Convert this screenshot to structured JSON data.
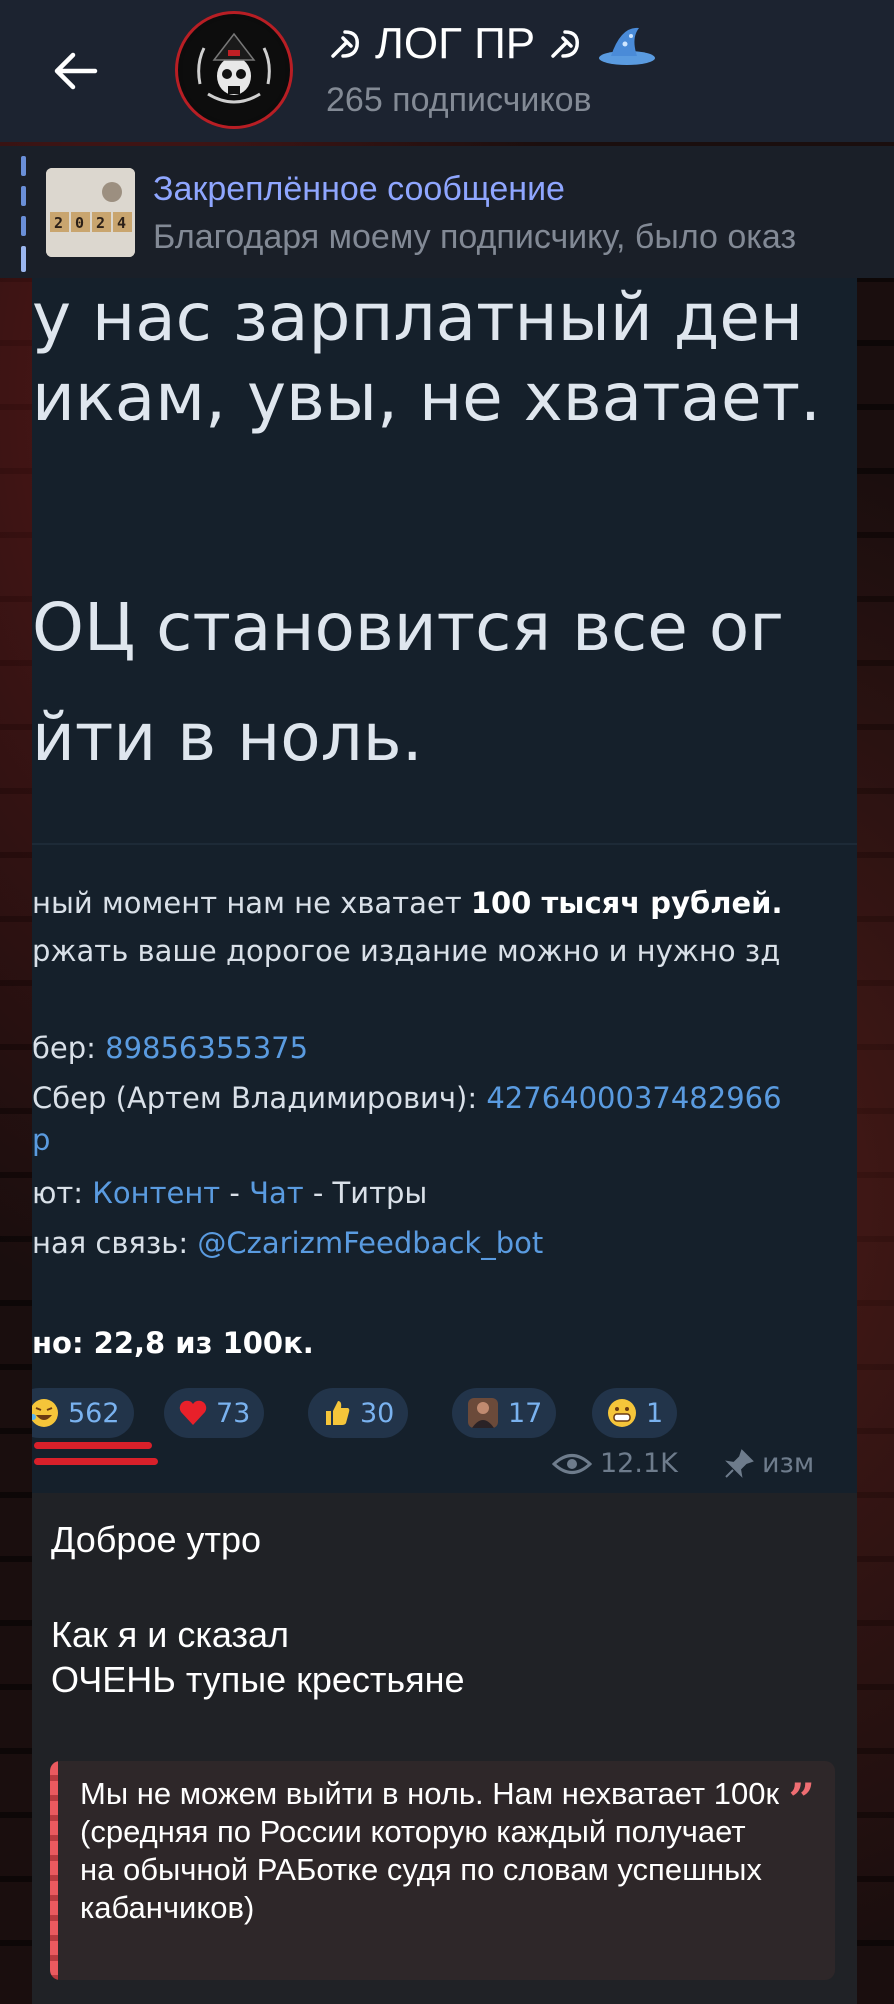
{
  "header": {
    "title": "ЛОГ ПР",
    "title_icon_left": "hammer-sickle-icon",
    "title_icon_right": "hammer-sickle-icon",
    "title_icon_extra": "wizard-hat-icon",
    "subscribers": "265 подписчиков",
    "colors": {
      "bar": "#1c2330",
      "subtitle": "#838a95",
      "avatar_ring": "#b81e24"
    }
  },
  "pinned": {
    "title": "Закреплённое сообщение",
    "preview": "Благодаря моему подписчику, было оказ",
    "thumb_text": "2024",
    "colors": {
      "title": "#8fa6ff",
      "indicator": "#6a8fd8"
    }
  },
  "screenshot": {
    "big_lines": [
      "у нас зарплатный ден",
      "икам, увы, не хватает.",
      "ОЦ становится все ог",
      "йти в ноль."
    ],
    "line1_plain": "ный момент нам не хватает ",
    "line1_bold": "100 тысяч рублей.",
    "line2": "ржать ваше дорогое издание можно и нужно зд",
    "sber_label": "бер: ",
    "sber_value": "89856355375",
    "card_label": "Сбер (Артем Владимирович): ",
    "card_value": "4276400037482966",
    "card_tail": "р",
    "links_label": "ют: ",
    "link_content": "Контент",
    "link_sep1": " - ",
    "link_chat": "Чат",
    "link_sep2": " - ",
    "link_titles": "Титры",
    "feedback_label": "ная связь: ",
    "feedback_value": "@CzarizmFeedback_bot",
    "progress_text": "но: 22,8 из 100к.",
    "reactions": [
      {
        "icon": "laughing-emoji-icon",
        "count": "562"
      },
      {
        "icon": "heart-icon",
        "count": "73"
      },
      {
        "icon": "thumbs-up-icon",
        "count": "30"
      },
      {
        "icon": "photo-sticker-icon",
        "count": "17"
      },
      {
        "icon": "grin-emoji-icon",
        "count": "1"
      }
    ],
    "views": "12.1K",
    "edited": "изм"
  },
  "caption": {
    "line1": "Доброе утро",
    "line2": "Как я и сказал",
    "line3": "ОЧЕНЬ тупые крестьяне"
  },
  "quote": {
    "text": "Мы не можем выйти в ноль. Нам нехватает 100к (средняя по России которую каждый получает на обычной РАБотке судя по словам успешных кабанчиков)"
  }
}
